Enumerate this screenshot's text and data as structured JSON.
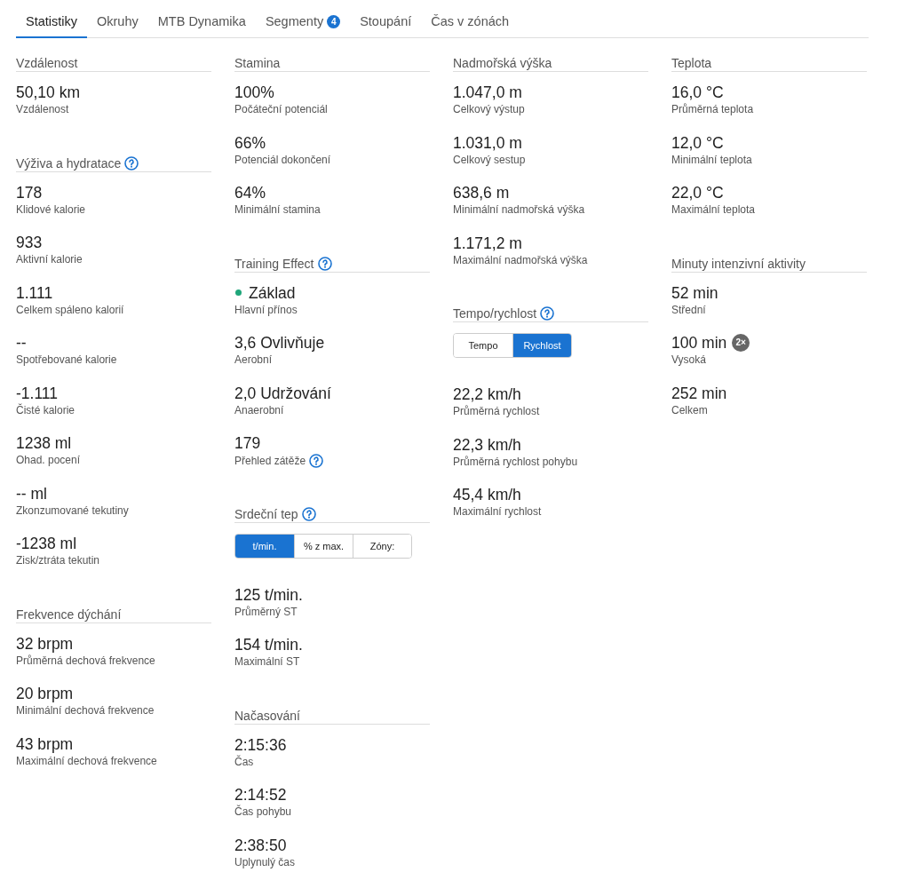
{
  "tabs": [
    {
      "label": "Statistiky",
      "selected": true
    },
    {
      "label": "Okruhy",
      "selected": false
    },
    {
      "label": "MTB Dynamika",
      "selected": false
    },
    {
      "label": "Segmenty",
      "selected": false,
      "badge": "4"
    },
    {
      "label": "Stoupání",
      "selected": false
    },
    {
      "label": "Čas v zónách",
      "selected": false
    }
  ],
  "columns": [
    {
      "sections": [
        {
          "title": "Vzdálenost",
          "help": false,
          "items": [
            {
              "value": "50,10 km",
              "label": "Vzdálenost",
              "help": false
            }
          ]
        },
        {
          "title": "Výživa a hydratace",
          "help": true,
          "items": [
            {
              "value": "178",
              "label": "Klidové kalorie",
              "help": false
            },
            {
              "value": "933",
              "label": "Aktivní kalorie",
              "help": false
            },
            {
              "value": "1.111",
              "label": "Celkem spáleno kalorií",
              "help": false
            },
            {
              "value": "--",
              "label": "Spotřebované kalorie",
              "help": false
            },
            {
              "value": "-1.111",
              "label": "Čisté kalorie",
              "help": false
            },
            {
              "value": "1238 ml",
              "label": "Ohad. pocení",
              "help": false
            },
            {
              "value": "-- ml",
              "label": "Zkonzumované tekutiny",
              "help": false
            },
            {
              "value": "-1238 ml",
              "label": "Zisk/ztráta tekutin",
              "help": false
            }
          ]
        },
        {
          "title": "Frekvence dýchání",
          "help": false,
          "items": [
            {
              "value": "32 brpm",
              "label": "Průměrná dechová frekvence",
              "help": false
            },
            {
              "value": "20 brpm",
              "label": "Minimální dechová frekvence",
              "help": false
            },
            {
              "value": "43 brpm",
              "label": "Maximální dechová frekvence",
              "help": false
            }
          ]
        }
      ]
    },
    {
      "sections": [
        {
          "title": "Stamina",
          "help": false,
          "items": [
            {
              "value": "100%",
              "label": "Počáteční potenciál",
              "help": false
            },
            {
              "value": "66%",
              "label": "Potenciál dokončení",
              "help": false
            },
            {
              "value": "64%",
              "label": "Minimální stamina",
              "help": false
            }
          ]
        },
        {
          "title": "Training Effect",
          "help": true,
          "items": [
            {
              "value": "Základ",
              "label": "Hlavní přínos",
              "help": false,
              "color": "#1fa67a"
            },
            {
              "value": "3,6 Ovlivňuje",
              "label": "Aerobní",
              "help": false
            },
            {
              "value": "2,0 Udržování",
              "label": "Anaerobní",
              "help": false
            },
            {
              "value": "179",
              "label": "Přehled zátěže",
              "help": true
            }
          ]
        },
        {
          "title": "Srdeční tep",
          "help": true,
          "toggle": [
            {
              "label": "t/min.",
              "selected": true
            },
            {
              "label": "% z max.",
              "selected": false
            },
            {
              "label": "Zóny:",
              "selected": false
            }
          ],
          "items": [
            {
              "value": "125 t/min.",
              "label": "Průměrný ST",
              "help": false
            },
            {
              "value": "154 t/min.",
              "label": "Maximální ST",
              "help": false
            }
          ]
        },
        {
          "title": "Načasování",
          "help": false,
          "items": [
            {
              "value": "2:15:36",
              "label": "Čas",
              "help": false
            },
            {
              "value": "2:14:52",
              "label": "Čas pohybu",
              "help": false
            },
            {
              "value": "2:38:50",
              "label": "Uplynulý čas",
              "help": false
            }
          ]
        }
      ]
    },
    {
      "sections": [
        {
          "title": "Nadmořská výška",
          "help": false,
          "items": [
            {
              "value": "1.047,0 m",
              "label": "Celkový výstup",
              "help": false
            },
            {
              "value": "1.031,0 m",
              "label": "Celkový sestup",
              "help": false
            },
            {
              "value": "638,6 m",
              "label": "Minimální nadmořská výška",
              "help": false
            },
            {
              "value": "1.171,2 m",
              "label": "Maximální nadmořská výška",
              "help": false
            }
          ]
        },
        {
          "title": "Tempo/rychlost",
          "help": true,
          "toggle": [
            {
              "label": "Tempo",
              "selected": false
            },
            {
              "label": "Rychlost",
              "selected": true
            }
          ],
          "items": [
            {
              "value": "22,2 km/h",
              "label": "Průměrná rychlost",
              "help": false
            },
            {
              "value": "22,3 km/h",
              "label": "Průměrná rychlost pohybu",
              "help": false
            },
            {
              "value": "45,4 km/h",
              "label": "Maximální rychlost",
              "help": false
            }
          ]
        }
      ]
    },
    {
      "sections": [
        {
          "title": "Teplota",
          "help": false,
          "items": [
            {
              "value": "16,0 °C",
              "label": "Průměrná teplota",
              "help": false
            },
            {
              "value": "12,0 °C",
              "label": "Minimální teplota",
              "help": false
            },
            {
              "value": "22,0 °C",
              "label": "Maximální teplota",
              "help": false
            }
          ]
        },
        {
          "title": "Minuty intenzivní aktivity",
          "help": false,
          "items": [
            {
              "value": "52 min",
              "label": "Střední",
              "help": false
            },
            {
              "value": "100 min",
              "label": "Vysoká",
              "help": false,
              "badge": "2×"
            },
            {
              "value": "252 min",
              "label": "Celkem",
              "help": false
            }
          ]
        }
      ]
    }
  ]
}
